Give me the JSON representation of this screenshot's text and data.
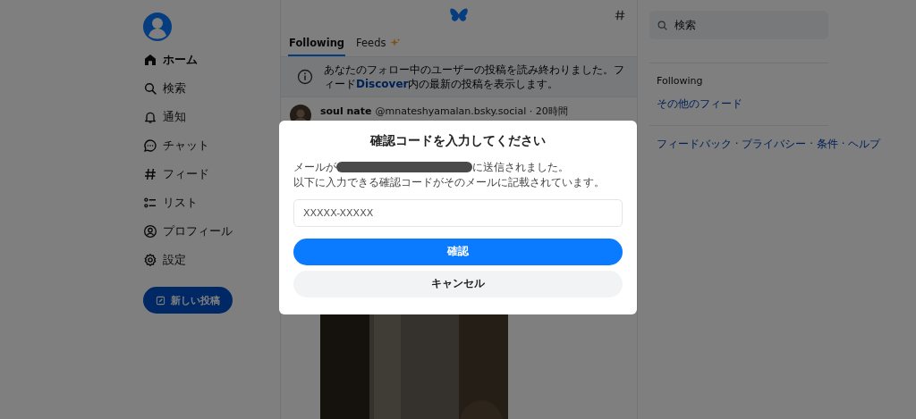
{
  "sidebar": {
    "items": [
      {
        "label": "ホーム",
        "kind": "home",
        "selected": true
      },
      {
        "label": "検索",
        "kind": "search",
        "selected": false
      },
      {
        "label": "通知",
        "kind": "bell",
        "selected": false
      },
      {
        "label": "チャット",
        "kind": "chat",
        "selected": false
      },
      {
        "label": "フィード",
        "kind": "hash",
        "selected": false
      },
      {
        "label": "リスト",
        "kind": "list",
        "selected": false
      },
      {
        "label": "プロフィール",
        "kind": "person",
        "selected": false
      },
      {
        "label": "設定",
        "kind": "gear",
        "selected": false
      }
    ],
    "new_post_button": "新しい投稿"
  },
  "feed": {
    "tabs": [
      {
        "label": "Following",
        "selected": true
      },
      {
        "label": "Feeds",
        "selected": false
      }
    ],
    "banner": "あなたのフォロー中のユーザーの投稿を読み終わりました。フィード**Discover**内の最新の投稿を表示します。",
    "post": {
      "author": "soul nate",
      "handle": "@mnateshyamalan.bsky.social · 20時間"
    }
  },
  "right": {
    "search": {
      "placeholder": "検索"
    },
    "feeds_title": "Following",
    "more_feeds_link": "その他のフィード",
    "footer": "フィードバック · プライバシー · 条件 · ヘルプ"
  },
  "dialog": {
    "title": "確認コードを入力してください",
    "message": {
      "before": "メールが",
      "redacted": true,
      "after": "に送信されました。",
      "note": "以下に入力できる確認コードがそのメールに記載されています。"
    },
    "code_field": {
      "placeholder": "XXXXX-XXXXX"
    },
    "buttons": [
      {
        "label": "確認",
        "kind": "primary"
      },
      {
        "label": "キャンセル",
        "kind": "secondary"
      }
    ]
  }
}
